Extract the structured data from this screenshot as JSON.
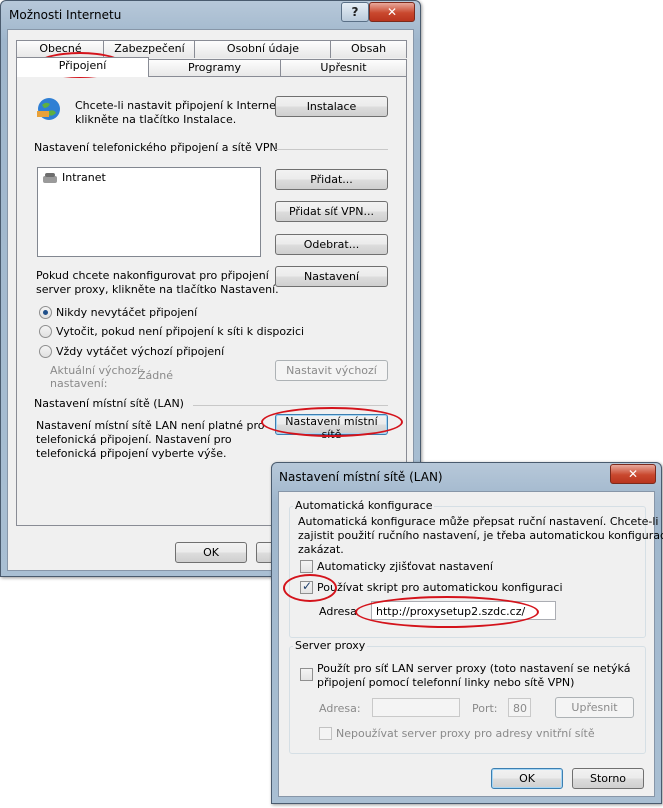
{
  "main_dialog": {
    "title": "Možnosti Internetu",
    "help_btn": "?",
    "close_btn": "✕",
    "tabs_row1": [
      "Obecné",
      "Zabezpečení",
      "Osobní údaje",
      "Obsah"
    ],
    "tabs_row2": [
      "Připojení",
      "Programy",
      "Upřesnit"
    ],
    "setup_text1": "Chcete-li nastavit připojení k Internetu,",
    "setup_text2": "klikněte na tlačítko Instalace.",
    "setup_button": "Instalace",
    "dialup_section": "Nastavení telefonického připojení a sítě VPN",
    "connections": [
      "Intranet"
    ],
    "add_button": "Přidat...",
    "add_vpn_button": "Přidat síť VPN...",
    "remove_button": "Odebrat...",
    "proxy_text1": "Pokud chcete nakonfigurovat pro připojení",
    "proxy_text2": "server proxy, klikněte na tlačítko Nastavení.",
    "settings_button": "Nastavení",
    "radio_never": "Nikdy nevytáčet připojení",
    "radio_dial_when_none": "Vytočit, pokud není připojení k síti k dispozici",
    "radio_always": "Vždy vytáčet výchozí připojení",
    "current_default_label1": "Aktuální výchozí",
    "current_default_label2": "nastavení:",
    "current_default_value": "Žádné",
    "set_default_button": "Nastavit výchozí",
    "lan_section": "Nastavení místní sítě (LAN)",
    "lan_text1": "Nastavení místní sítě LAN není platné pro",
    "lan_text2": "telefonická připojení. Nastavení pro",
    "lan_text3": "telefonická připojení vyberte výše.",
    "lan_button": "Nastavení místní sítě",
    "ok_button": "OK"
  },
  "lan_dialog": {
    "title": "Nastavení místní sítě (LAN)",
    "close_btn": "✕",
    "auto_group": "Automatická konfigurace",
    "auto_text1": "Automatická konfigurace může přepsat ruční nastavení. Chcete-li",
    "auto_text2": "zajistit použití ručního nastavení, je třeba automatickou konfiguraci",
    "auto_text3": "zakázat.",
    "auto_detect": "Automaticky zjišťovat nastavení",
    "auto_detect_checked": false,
    "use_script": "Používat skript pro automatickou konfiguraci",
    "use_script_checked": true,
    "address_label": "Adresa",
    "address_value": "http://proxysetup2.szdc.cz/",
    "proxy_group": "Server proxy",
    "use_proxy1": "Použít pro síť LAN server proxy (toto nastavení se netýká",
    "use_proxy2": "připojení pomocí telefonní linky nebo sítě VPN)",
    "proxy_address_label": "Adresa:",
    "port_label": "Port:",
    "port_value": "80",
    "advanced_button": "Upřesnit",
    "bypass_local": "Nepoužívat server proxy pro adresy vnitřní sítě",
    "ok_button": "OK",
    "cancel_button": "Storno"
  },
  "colors": {
    "highlight_ellipse": "#d4131b"
  }
}
